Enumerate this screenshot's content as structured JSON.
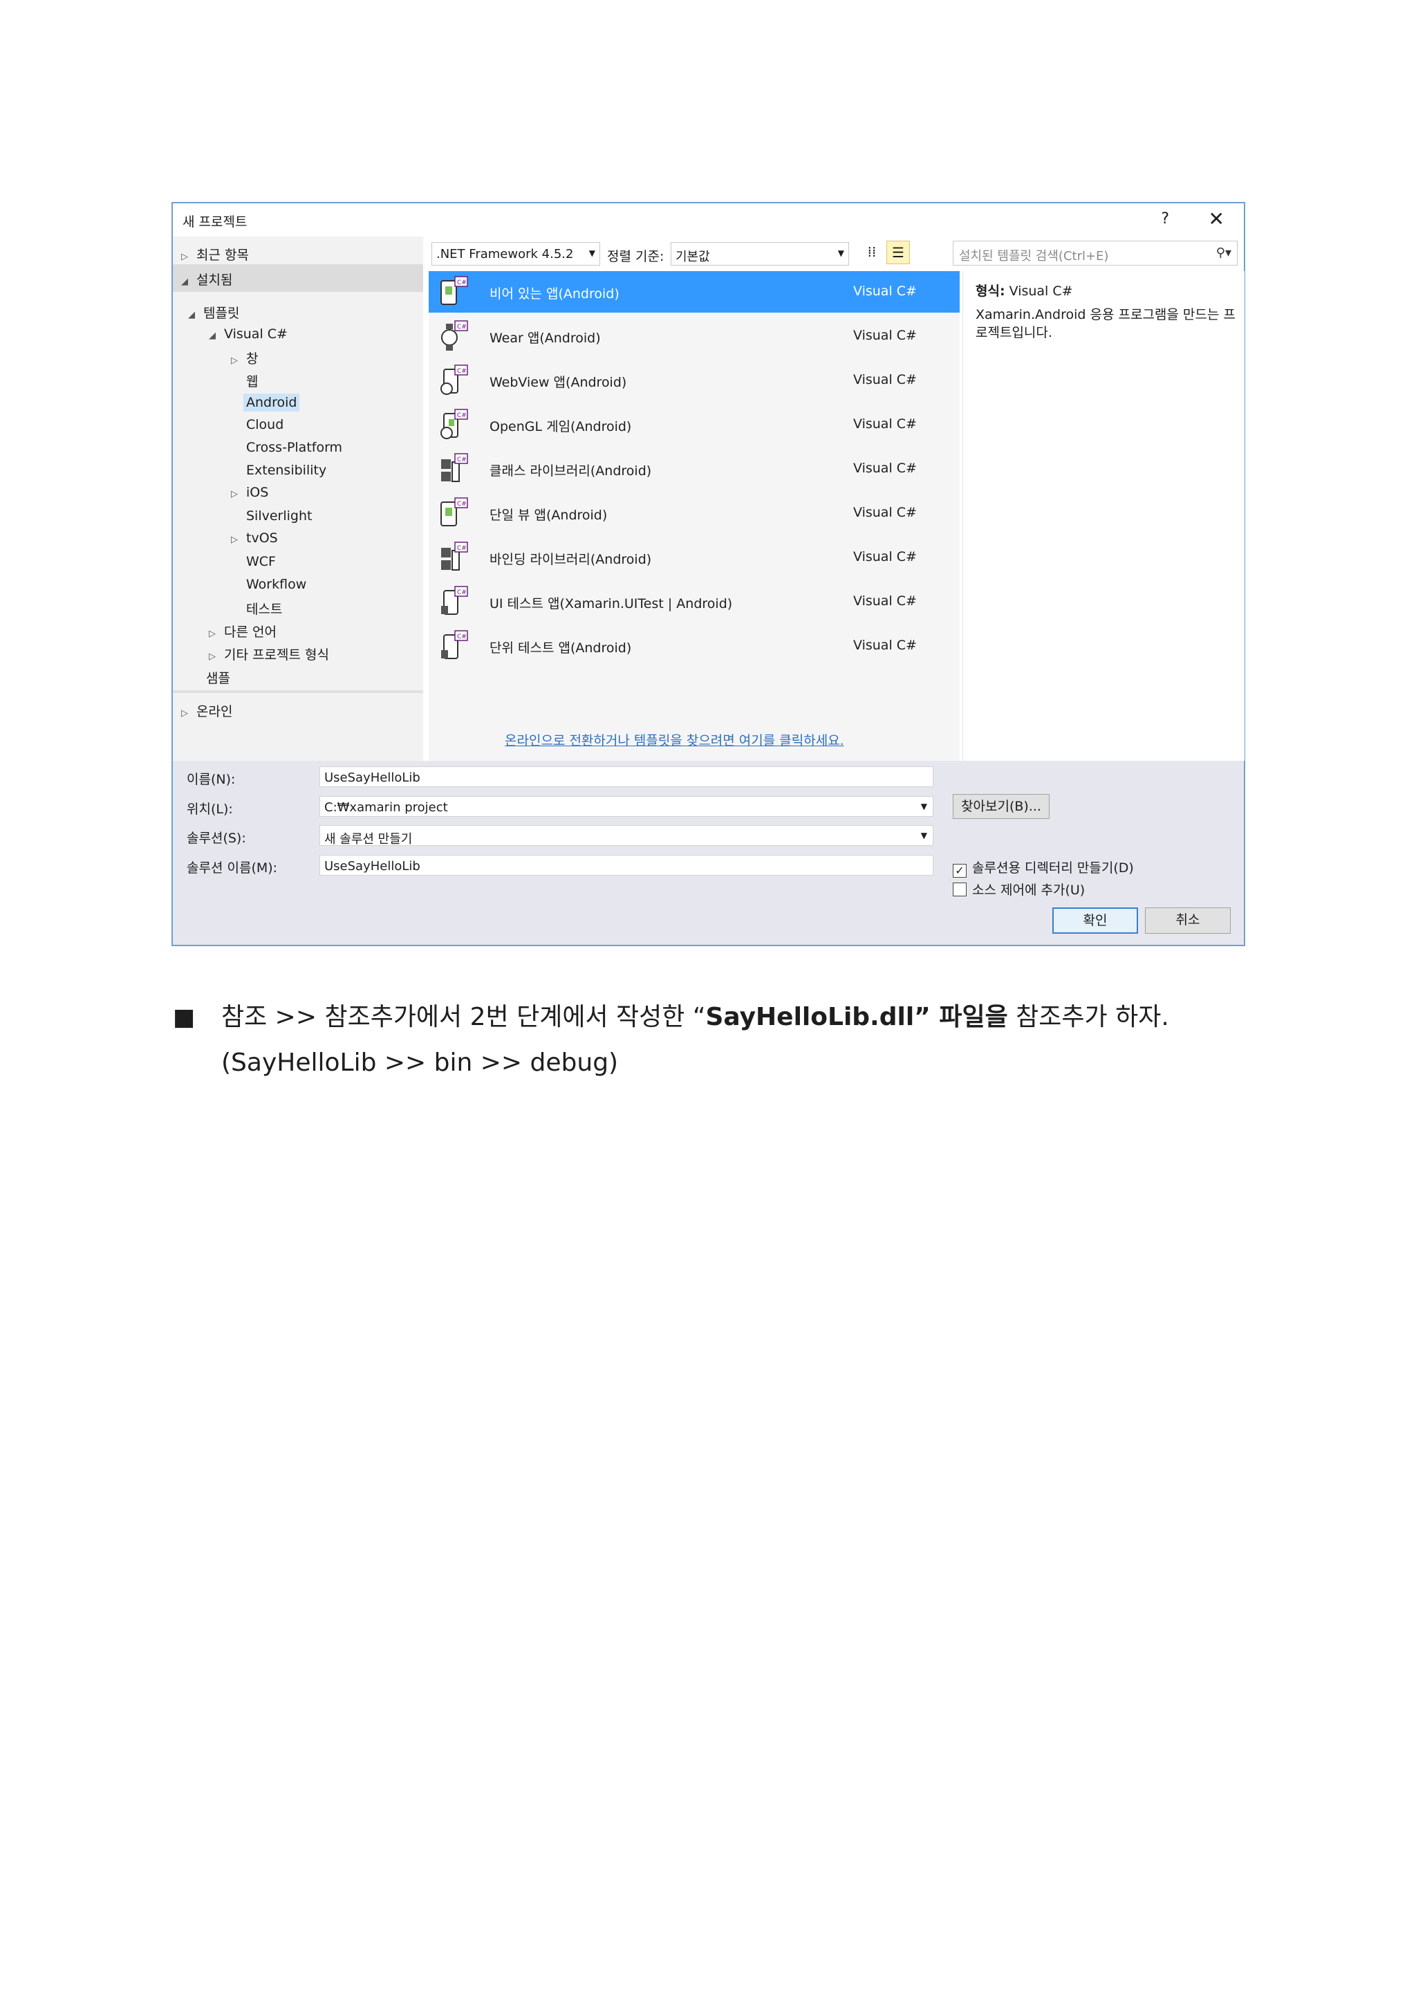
{
  "dialog": {
    "title": "새 프로젝트",
    "help": "?",
    "close": "✕"
  },
  "tree": {
    "recent": "최근 항목",
    "installed": "설치됨",
    "templates": "템플릿",
    "visual_csharp": "Visual C#",
    "children": [
      "창",
      "웹",
      "Android",
      "Cloud",
      "Cross-Platform",
      "Extensibility",
      "iOS",
      "Silverlight",
      "tvOS",
      "WCF",
      "Workflow",
      "테스트"
    ],
    "other_languages": "다른 언어",
    "other_project_types": "기타 프로젝트 형식",
    "samples": "샘플",
    "online": "온라인"
  },
  "toolbar": {
    "framework": ".NET Framework 4.5.2",
    "sort_label": "정렬 기준:",
    "sort_value": "기본값",
    "search_placeholder": "설치된 템플릿 검색(Ctrl+E)"
  },
  "templates": [
    {
      "name": "비어 있는 앱(Android)",
      "lang": "Visual C#"
    },
    {
      "name": "Wear 앱(Android)",
      "lang": "Visual C#"
    },
    {
      "name": "WebView 앱(Android)",
      "lang": "Visual C#"
    },
    {
      "name": "OpenGL 게임(Android)",
      "lang": "Visual C#"
    },
    {
      "name": "클래스 라이브러리(Android)",
      "lang": "Visual C#"
    },
    {
      "name": "단일 뷰 앱(Android)",
      "lang": "Visual C#"
    },
    {
      "name": "바인딩 라이브러리(Android)",
      "lang": "Visual C#"
    },
    {
      "name": "UI 테스트 앱(Xamarin.UITest | Android)",
      "lang": "Visual C#"
    },
    {
      "name": "단위 테스트 앱(Android)",
      "lang": "Visual C#"
    }
  ],
  "online_link": "온라인으로 전환하거나 템플릿을 찾으려면 여기를 클릭하세요.",
  "info": {
    "type_label": "형식:",
    "type_value": "Visual C#",
    "description": "Xamarin.Android 응용 프로그램을 만드는 프로젝트입니다."
  },
  "form": {
    "name_label": "이름(N):",
    "name_value": "UseSayHelloLib",
    "location_label": "위치(L):",
    "location_value": "C:₩xamarin project",
    "solution_label": "솔루션(S):",
    "solution_value": "새 솔루션 만들기",
    "solution_name_label": "솔루션 이름(M):",
    "solution_name_value": "UseSayHelloLib",
    "browse": "찾아보기(B)...",
    "create_dir": "솔루션용 디렉터리 만들기(D)",
    "add_source_control": "소스 제어에 추가(U)",
    "ok": "확인",
    "cancel": "취소"
  },
  "paragraph": {
    "bullet": "■",
    "part1": "참조 >> 참조추가에서 2번 단계에서 작성한 “",
    "part2_bold": "SayHelloLib.dll” 파일을",
    "part3": " 참조추가 하자.",
    "line2": "(SayHelloLib >> bin >> debug)"
  }
}
